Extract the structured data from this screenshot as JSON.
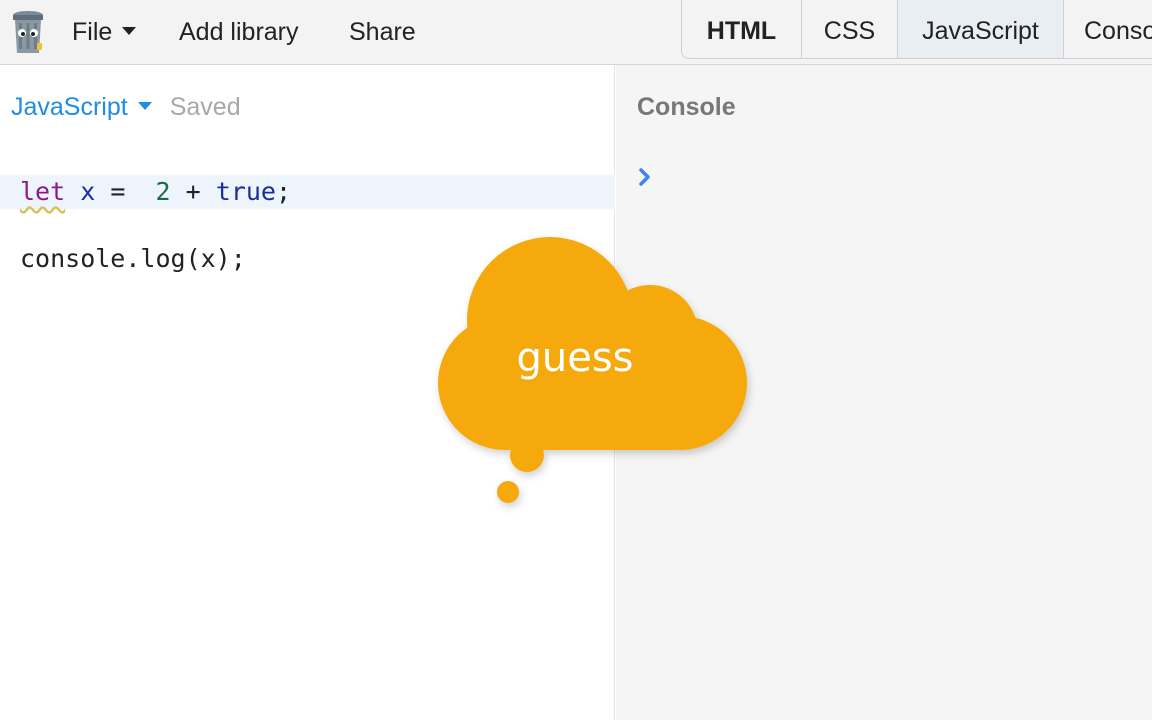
{
  "toolbar": {
    "file_label": "File",
    "add_library_label": "Add library",
    "share_label": "Share",
    "tabs": [
      {
        "label": "HTML"
      },
      {
        "label": "CSS"
      },
      {
        "label": "JavaScript"
      },
      {
        "label": "Console"
      }
    ]
  },
  "editor": {
    "language": "JavaScript",
    "status": "Saved",
    "code": {
      "line1": {
        "kw": "let",
        "var": "x",
        "op1": "=",
        "num": "2",
        "op2": "+",
        "bool": "true",
        "end": ";"
      },
      "line2": "console.log(x);"
    }
  },
  "console": {
    "title": "Console"
  },
  "overlay": {
    "thought_text": "guess",
    "color": "#f5a90a"
  },
  "colors": {
    "accent": "#1f8ce6",
    "prompt": "#3b82f6"
  }
}
